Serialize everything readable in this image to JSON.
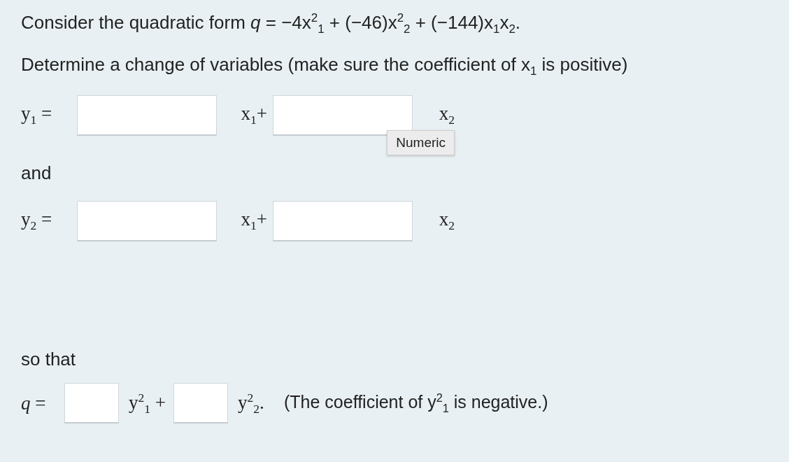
{
  "intro": "Consider the quadratic form *q* = −4x$^{2}$$_{1}$ + (−46)x$^{2}$$_{2}$ + (−144)x$_{1}$x$_{2}$.",
  "instruction": "Determine a change of variables (make sure the coefficient of x$_{1}$ is positive)",
  "equations": [
    {
      "lhs": "y$_{1}$ =",
      "fields": [
        {
          "suffix": "x$_{1}$+"
        },
        {
          "suffix": "x$_{2}$",
          "tooltip": "Numeric"
        }
      ]
    },
    {
      "lhs": "y$_{2}$ =",
      "fields": [
        {
          "suffix": "x$_{1}$+"
        },
        {
          "suffix": "x$_{2}$"
        }
      ]
    }
  ],
  "connector": "and",
  "so_that": "so that",
  "result": {
    "lhs": "*q* =",
    "fields": [
      {
        "suffix": "y$^{2}$$_{1}$ +"
      },
      {
        "suffix": "y$^{2}$$_{2}$."
      }
    ],
    "note": "(The coefficient of y$^{2}$$_{1}$ is negative.)"
  }
}
